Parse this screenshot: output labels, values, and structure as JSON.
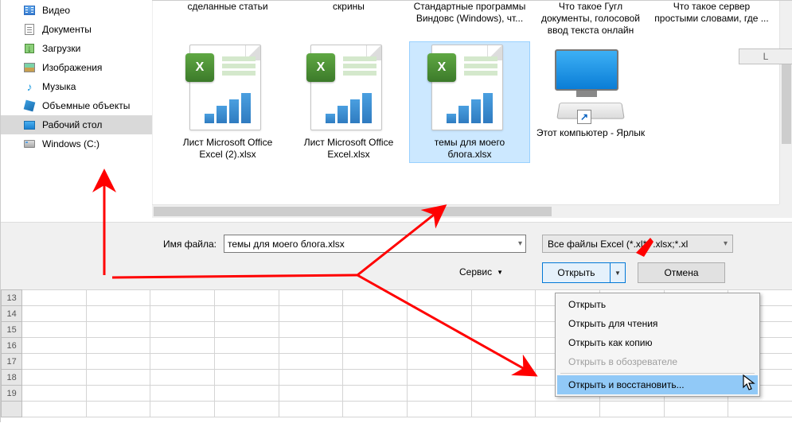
{
  "sidebar": {
    "items": [
      {
        "label": "Видео"
      },
      {
        "label": "Документы"
      },
      {
        "label": "Загрузки"
      },
      {
        "label": "Изображения"
      },
      {
        "label": "Музыка"
      },
      {
        "label": "Объемные объекты"
      },
      {
        "label": "Рабочий стол"
      },
      {
        "label": "Windows (C:)"
      }
    ]
  },
  "row1": [
    "сделанные статьи",
    "скрины",
    "Стандартные программы Виндовс (Windows), чт...",
    "Что такое Гугл документы, голосовой ввод текста онлайн",
    "Что такое сервер простыми словами, где ..."
  ],
  "row2": [
    {
      "label": "Лист Microsoft Office Excel (2).xlsx",
      "type": "excel"
    },
    {
      "label": "Лист Microsoft Office Excel.xlsx",
      "type": "excel"
    },
    {
      "label": "темы для моего блога.xlsx",
      "type": "excel",
      "selected": true
    },
    {
      "label": "Этот компьютер - Ярлык",
      "type": "pc"
    }
  ],
  "filename_label": "Имя файла:",
  "filename_value": "темы для моего блога.xlsx",
  "filetype_value": "Все файлы Excel (*.xl*;*.xlsx;*.xl",
  "service_label": "Сервис",
  "open_label": "Открыть",
  "cancel_label": "Отмена",
  "dropdown": {
    "items": [
      {
        "label": "Открыть"
      },
      {
        "label": "Открыть для чтения"
      },
      {
        "label": "Открыть как копию"
      },
      {
        "label": "Открыть в обозревателе",
        "disabled": true
      },
      {
        "label": "Открыть и восстановить...",
        "hover": true
      }
    ]
  },
  "sheet": {
    "row_start": 13,
    "row_end": 19,
    "col_header": "L"
  }
}
